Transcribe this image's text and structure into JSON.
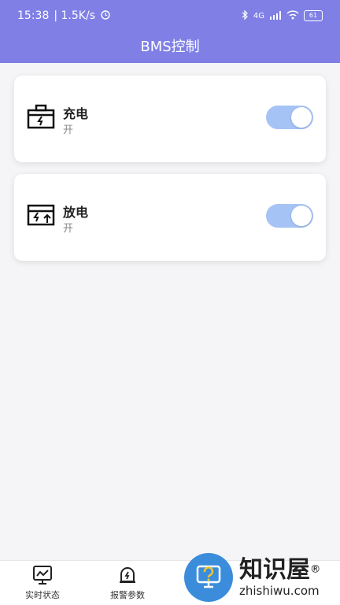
{
  "status_bar": {
    "time": "15:38",
    "speed": "| 1.5K/s",
    "battery": "61",
    "signal": "4G"
  },
  "header": {
    "title": "BMS控制"
  },
  "cards": [
    {
      "title": "充电",
      "state": "开",
      "on": true
    },
    {
      "title": "放电",
      "state": "开",
      "on": true
    }
  ],
  "colors": {
    "header": "#7f7fe6",
    "toggle_on": "#a6c3f5",
    "accent": "#3b8ddb"
  },
  "bottom_nav": [
    {
      "label": "实时状态",
      "icon": "monitor-chart-icon"
    },
    {
      "label": "报警参数",
      "icon": "alarm-bell-icon"
    },
    {
      "label": "",
      "icon": "control-icon"
    },
    {
      "label": "",
      "icon": "settings-icon"
    }
  ],
  "watermark": {
    "cn": "知识屋",
    "en": "zhishiwu.com",
    "mark": "®"
  }
}
